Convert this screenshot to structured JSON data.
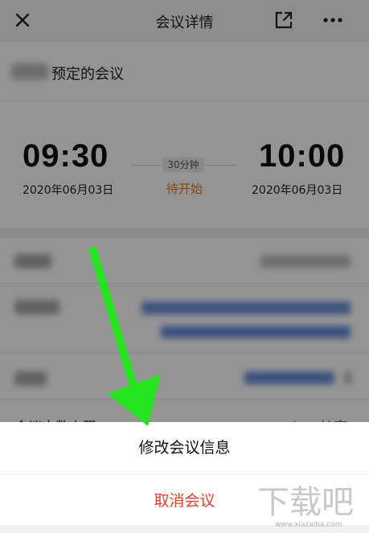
{
  "header": {
    "title": "会议详情"
  },
  "meeting": {
    "name_visible": "预定的会议"
  },
  "time": {
    "start": "09:30",
    "start_date": "2020年06月03日",
    "end": "10:00",
    "end_date": "2020年06月03日",
    "duration": "30分钟",
    "status": "待开始"
  },
  "rows": {
    "limit_label": "会议人数上限",
    "limit_value": "300人",
    "limit_action": "扩容"
  },
  "sheet": {
    "edit_label": "修改会议信息",
    "cancel_label": "取消会议"
  },
  "watermark": {
    "text": "下载吧",
    "url": "www.xiazaiba.com"
  },
  "colors": {
    "status": "#e07a2a",
    "cancel": "#e0432f",
    "arrow": "#22e31c"
  }
}
